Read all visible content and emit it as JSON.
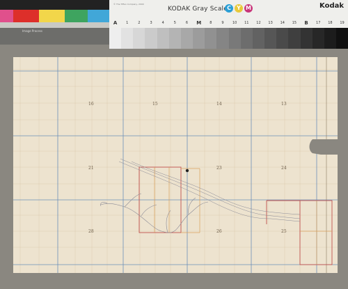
{
  "color_strip": {
    "text": "Image Process"
  },
  "gray_card": {
    "title": "KODAK Gray Scale",
    "brand": "Kodak",
    "fine_print": "© The Tiffen Company, 2000",
    "cmy": [
      "C",
      "Y",
      "M"
    ],
    "step_labels": [
      "A",
      "1",
      "2",
      "3",
      "4",
      "5",
      "6",
      "M",
      "8",
      "9",
      "10",
      "11",
      "12",
      "13",
      "14",
      "15",
      "B",
      "17",
      "18",
      "19"
    ]
  },
  "map": {
    "sections": {
      "r1c1": "16",
      "r1c2": "15",
      "r1c3": "14",
      "r1c4": "13",
      "r2c1": "21",
      "r2c3": "23",
      "r2c4": "24",
      "r3c1": "28",
      "r3c3": "26",
      "r3c4": "25"
    },
    "colors": {
      "paper": "#ede3cf",
      "grid": "#6b8fb8",
      "boundary_red": "#c0504d",
      "boundary_orange": "#d9a05b",
      "ink": "#6b5d4a"
    }
  }
}
